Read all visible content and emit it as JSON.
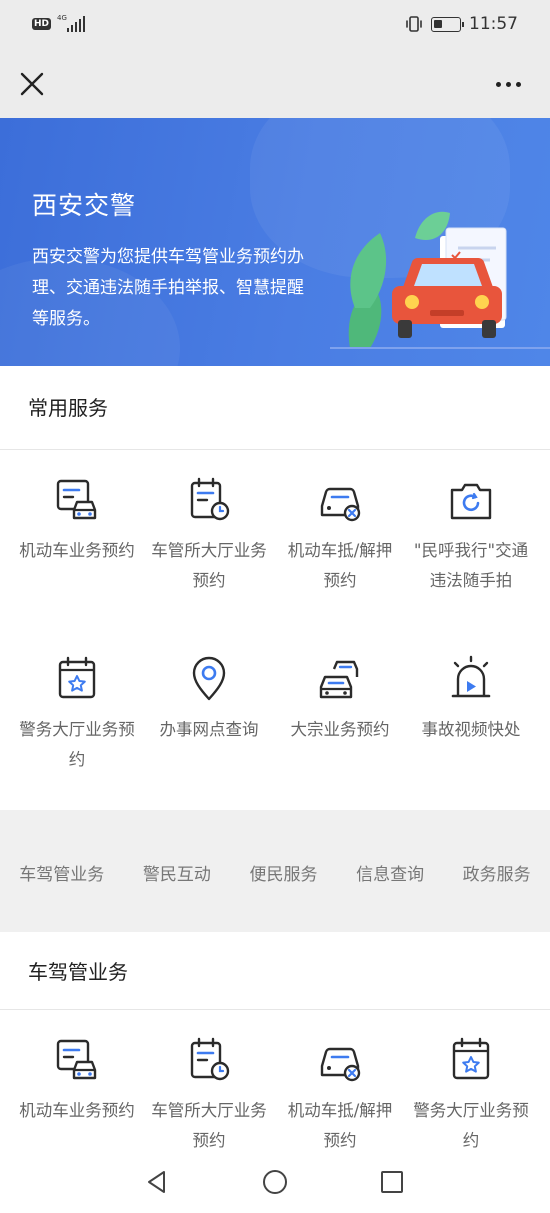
{
  "status_bar": {
    "network_badge": "HD",
    "signal_label": "4G",
    "time": "11:57"
  },
  "banner": {
    "title": "西安交警",
    "description": "西安交警为您提供车驾管业务预约办理、交通违法随手拍举报、智慧提醒等服务。"
  },
  "common_services": {
    "title": "常用服务",
    "items": [
      {
        "label": "机动车业务预约",
        "icon": "vehicle-document-icon"
      },
      {
        "label": "车管所大厅业务预约",
        "icon": "calendar-clock-icon"
      },
      {
        "label": "机动车抵/解押预约",
        "icon": "car-cancel-icon"
      },
      {
        "label": "\"民呼我行\"交通违法随手拍",
        "icon": "camera-icon"
      },
      {
        "label": "警务大厅业务预约",
        "icon": "police-badge-calendar-icon"
      },
      {
        "label": "办事网点查询",
        "icon": "location-pin-icon"
      },
      {
        "label": "大宗业务预约",
        "icon": "multiple-cars-icon"
      },
      {
        "label": "事故视频快处",
        "icon": "siren-video-icon"
      }
    ]
  },
  "category_tabs": [
    "车驾管业务",
    "警民互动",
    "便民服务",
    "信息查询",
    "政务服务"
  ],
  "vehicle_services": {
    "title": "车驾管业务",
    "items": [
      {
        "label": "机动车业务预约",
        "icon": "vehicle-document-icon"
      },
      {
        "label": "车管所大厅业务预约",
        "icon": "calendar-clock-icon"
      },
      {
        "label": "机动车抵/解押预约",
        "icon": "car-cancel-icon"
      },
      {
        "label": "警务大厅业务预约",
        "icon": "police-badge-calendar-icon"
      }
    ]
  },
  "colors": {
    "accent_blue": "#3f72dd",
    "icon_dark": "#2b2b2b",
    "icon_blue": "#3d7bf0",
    "car_red": "#e8553c"
  }
}
